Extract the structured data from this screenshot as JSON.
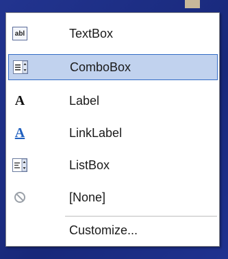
{
  "menu": {
    "items": [
      {
        "label": "TextBox",
        "icon": "textbox-icon",
        "selected": false
      },
      {
        "label": "ComboBox",
        "icon": "combobox-icon",
        "selected": true
      },
      {
        "label": "Label",
        "icon": "label-icon",
        "selected": false
      },
      {
        "label": "LinkLabel",
        "icon": "linklabel-icon",
        "selected": false
      },
      {
        "label": "ListBox",
        "icon": "listbox-icon",
        "selected": false
      },
      {
        "label": "[None]",
        "icon": "none-icon",
        "selected": false
      }
    ],
    "customize_label": "Customize..."
  },
  "colors": {
    "selection_bg": "#c1d2ee",
    "selection_border": "#316ac5",
    "link_color": "#1f5fbf"
  }
}
